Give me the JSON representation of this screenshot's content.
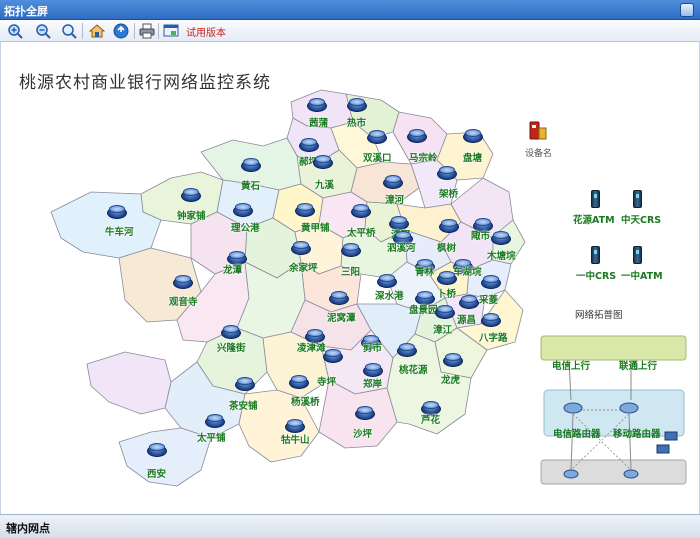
{
  "window": {
    "title": "拓扑全屏"
  },
  "toolbar": {
    "buttons": [
      {
        "name": "zoom-in-button",
        "icon": "zoom-in-icon"
      },
      {
        "name": "zoom-out-button",
        "icon": "zoom-out-icon"
      },
      {
        "name": "zoom-fit-button",
        "icon": "zoom-fit-icon"
      },
      {
        "name": "home-button",
        "icon": "home-icon"
      },
      {
        "name": "refresh-button",
        "icon": "refresh-icon"
      },
      {
        "name": "print-button",
        "icon": "print-icon"
      },
      {
        "name": "export-button",
        "icon": "export-icon"
      }
    ],
    "trial_label": "试用版本"
  },
  "map": {
    "title": "桃源农村商业银行网络监控系统",
    "device_legend_label": "设备名",
    "nodes": [
      {
        "label": "茜蒲"
      },
      {
        "label": "热市"
      },
      {
        "label": "郝坪"
      },
      {
        "label": "双溪口"
      },
      {
        "label": "马宗岭"
      },
      {
        "label": "盘塘"
      },
      {
        "label": "九溪"
      },
      {
        "label": "黄石"
      },
      {
        "label": "漳河"
      },
      {
        "label": "架桥"
      },
      {
        "label": "钟家铺"
      },
      {
        "label": "理公港"
      },
      {
        "label": "黄甲铺"
      },
      {
        "label": "太平桥"
      },
      {
        "label": "漆河"
      },
      {
        "label": "牛车河"
      },
      {
        "label": "泗溪河"
      },
      {
        "label": "枫树"
      },
      {
        "label": "陬市"
      },
      {
        "label": "木塘垸"
      },
      {
        "label": "龙潭"
      },
      {
        "label": "余家坪"
      },
      {
        "label": "三阳"
      },
      {
        "label": "青林"
      },
      {
        "label": "车湖垸"
      },
      {
        "label": "观音寺"
      },
      {
        "label": "深水港"
      },
      {
        "label": "卜桥"
      },
      {
        "label": "采菱"
      },
      {
        "label": "泥窝潭"
      },
      {
        "label": "盘景园"
      },
      {
        "label": "源昌"
      },
      {
        "label": "漳江"
      },
      {
        "label": "八字路"
      },
      {
        "label": "兴隆街"
      },
      {
        "label": "凌津滩"
      },
      {
        "label": "剪市"
      },
      {
        "label": "桃花源"
      },
      {
        "label": "寺坪"
      },
      {
        "label": "郑岸"
      },
      {
        "label": "龙虎"
      },
      {
        "label": "茶安铺"
      },
      {
        "label": "杨溪桥"
      },
      {
        "label": "太平铺"
      },
      {
        "label": "沙坪"
      },
      {
        "label": "芦花"
      },
      {
        "label": "牯牛山"
      },
      {
        "label": "西安"
      }
    ]
  },
  "legend_devices": [
    {
      "label": "花源ATM"
    },
    {
      "label": "中天CRS"
    },
    {
      "label": "一中CRS"
    },
    {
      "label": "一中ATM"
    }
  ],
  "topology": {
    "title": "网络拓普图",
    "telecom_uplink": "电信上行",
    "unicom_uplink": "联通上行",
    "telecom_router": "电信路由器",
    "mobile_router": "移动路由器"
  },
  "statusbar": {
    "text": "辖内网点"
  },
  "colors": {
    "titlebar": "#2d6cc0",
    "label_green": "#1a7a20",
    "trial_red": "#cc2222",
    "router_blue": "#1b3f86"
  }
}
